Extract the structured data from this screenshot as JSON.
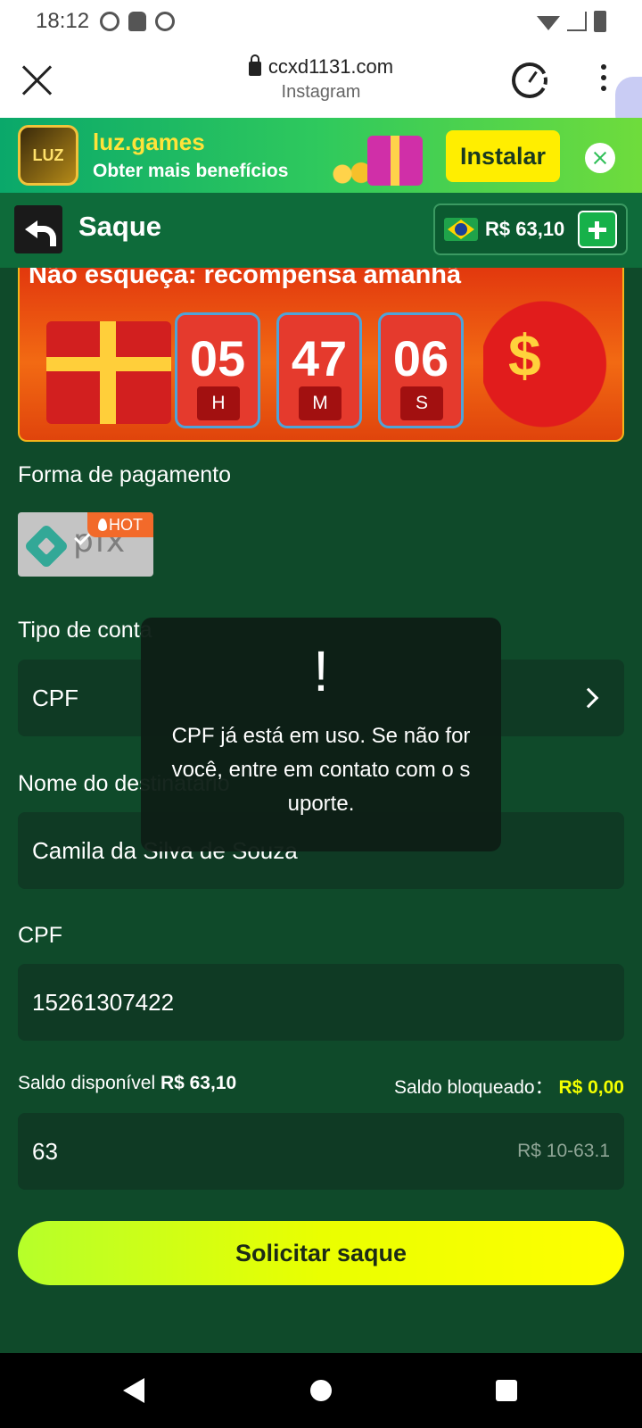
{
  "status_bar": {
    "time": "18:12"
  },
  "browser": {
    "url": "ccxd1131.com",
    "subtitle": "Instagram"
  },
  "install_banner": {
    "app_name": "luz.games",
    "tagline": "Obter mais benefícios",
    "logo_text": "LUZ",
    "install_label": "Instalar"
  },
  "header": {
    "title": "Saque",
    "balance": "R$ 63,10"
  },
  "promo": {
    "title": "Não esqueça: recompensa amanhã",
    "countdown": [
      {
        "value": "05",
        "unit": "H"
      },
      {
        "value": "47",
        "unit": "M"
      },
      {
        "value": "06",
        "unit": "S"
      }
    ]
  },
  "form": {
    "payment_label": "Forma de pagamento",
    "pix_text": "pix",
    "hot_badge": "HOT",
    "account_type_label": "Tipo de conta",
    "account_type_value": "CPF",
    "recipient_label": "Nome do destinatário",
    "recipient_value": "Camila da Silva de Souza",
    "cpf_label": "CPF",
    "cpf_value": "15261307422",
    "available_label": "Saldo disponível",
    "available_value": "R$ 63,10",
    "blocked_label": "Saldo bloqueado：",
    "blocked_value": "R$ 0,00",
    "amount_value": "63",
    "amount_range": "R$ 10-63.1",
    "submit_label": "Solicitar saque"
  },
  "toast": {
    "icon": "!",
    "message": "CPF já está em uso. Se não for você, entre em contato com o suporte."
  },
  "colors": {
    "accent": "#eaff00",
    "background": "#0f4a2a",
    "header": "#0e6b3a"
  }
}
